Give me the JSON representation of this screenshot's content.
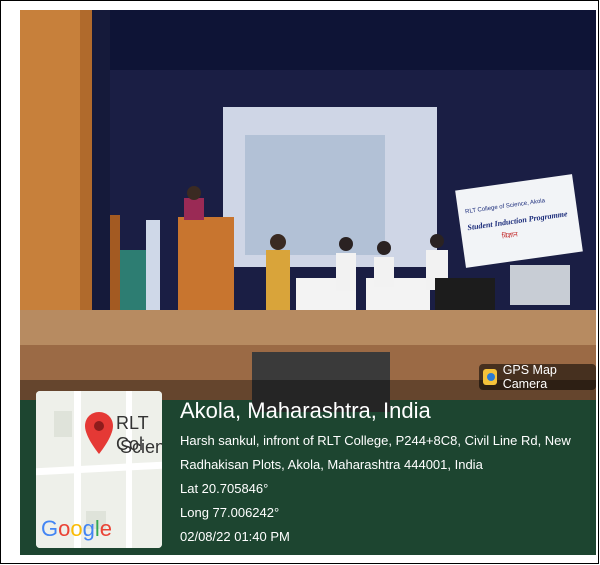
{
  "banner": {
    "college": "RLT College of Science, Akola",
    "programme": "Student Induction Programme",
    "subtitle": "विज्ञान"
  },
  "badge": {
    "label": "GPS Map Camera",
    "icon": "camera-icon"
  },
  "geo": {
    "place": "Akola, Maharashtra, India",
    "address_line1": "Harsh sankul, infront of RLT College, P244+8C8, Civil Line Rd, New",
    "address_line2": "Radhakisan Plots, Akola, Maharashtra 444001, India",
    "lat": "Lat 20.705846°",
    "long": "Long 77.006242°",
    "datetime": "02/08/22 01:40 PM"
  },
  "map": {
    "label_top": "RLT Col",
    "label_bottom": "Science",
    "google": [
      "G",
      "o",
      "o",
      "g",
      "l",
      "e"
    ],
    "pin_icon": "location-pin-icon",
    "colors": {
      "g1": "#4285F4",
      "o1": "#EA4335",
      "o2": "#FBBC05",
      "g2": "#4285F4",
      "l": "#34A853",
      "e": "#EA4335"
    }
  }
}
